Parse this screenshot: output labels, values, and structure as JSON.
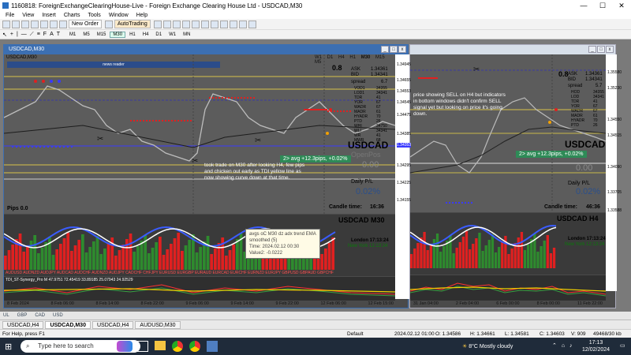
{
  "window": {
    "title": "1160818: ForeignExchangeClearingHouse-Live - Foreign Exchange Clearing House Ltd - USDCAD,M30",
    "minimize": "—",
    "maximize": "☐",
    "close": "✕"
  },
  "menu": [
    "File",
    "View",
    "Insert",
    "Charts",
    "Tools",
    "Window",
    "Help"
  ],
  "toolbar": {
    "new_order": "New Order",
    "autotrading": "AutoTrading"
  },
  "timeframes": [
    "M1",
    "M5",
    "M15",
    "M30",
    "H1",
    "H4",
    "D1",
    "W1",
    "MN"
  ],
  "left_chart": {
    "title": "USDCAD,M30",
    "subtitle": "USDCAD,M30",
    "news": "news reader",
    "tfs": [
      "W1",
      "D1",
      "H4",
      "H1",
      "M30",
      "M15",
      "M5"
    ],
    "value_top": "0.8",
    "info": {
      "ask_label": "ASK",
      "ask": "1.34361",
      "bid_label": "BID",
      "bid": "1.34341",
      "spread_label": "spread",
      "spread": "6.7"
    },
    "indicators": [
      {
        "k": "VOD1",
        "v": "34355"
      },
      {
        "k": "LOD1",
        "v": "34341"
      },
      {
        "k": "TDR",
        "v": "41"
      },
      {
        "k": "YOR",
        "v": "67"
      },
      {
        "k": "WADR",
        "v": "67"
      },
      {
        "k": "MADR",
        "v": "61"
      },
      {
        "k": "HYADR",
        "v": "70"
      },
      {
        "k": "PTD",
        "v": "26"
      },
      {
        "k": "WHI",
        "v": "34750"
      },
      {
        "k": "WLI",
        "v": "34341"
      },
      {
        "k": "WR",
        "v": "41"
      },
      {
        "k": "MWR",
        "v": "68"
      }
    ],
    "symbol": "USDCAD",
    "banner": "2> avg +12.3pips, +0.02%",
    "open_pos": "OpenPos",
    "open_pos_val": "0.00",
    "daily_pl": "Daily P/L",
    "daily_pl_val": "0.02%",
    "candle_time_label": "Candle time:",
    "candle_time": "16:36",
    "pips": "Pips 0.0",
    "note": "took trade on M30 after looking H4, few pips and chicken out early as TDI yellow line as now showing curve down at that time.",
    "prices": [
      "1.34945",
      "1.34655",
      "1.34553",
      "1.34545",
      "1.34475",
      "1.34353",
      "1.34385",
      "1.34295",
      "1.34225",
      "1.34155"
    ],
    "osc_symbol": "USDCAD M30",
    "london": "London 17:13:24",
    "newyork": "New York 12:13:24",
    "pairs": "AUDUSD AUDNZD AUDJPY AUDCAD AUDCHF AUDNZD AUDJPY CADCHF CHFJPY EURUSD EURGBP EURAUD EURCAD EURCHF EURNZD EURJPY GBPUSD GBPAUD GBPCHF",
    "tdi_label": "TDI_ST-Synergy_Pro M 47.9751 72.45419 33.89185 25.07943 24.92529",
    "tooltip": {
      "l1": "avgs oC M30 dz adx trend EMA",
      "l2": "smoothed (5)",
      "l3": "Time: 2024.02.12 00:30",
      "l4": "Value2: -0.0222"
    },
    "dates": [
      "8 Feb 2024",
      "8 Feb 06:00",
      "8 Feb 14:00",
      "8 Feb 22:00",
      "9 Feb 06:00",
      "9 Feb 14:00",
      "9 Feb 22:00",
      "12 Feb 06:00",
      "12 Feb 15:00"
    ]
  },
  "right_chart": {
    "value_top": "0.8",
    "info": {
      "ask_label": "ASK",
      "ask": "1.34361",
      "bid_label": "BID",
      "bid": "1.34341",
      "spread_label": "spread",
      "spread": "5.7"
    },
    "indicators": [
      {
        "k": "HOD",
        "v": "34355"
      },
      {
        "k": "LOD",
        "v": "34341"
      },
      {
        "k": "TDR",
        "v": "41"
      },
      {
        "k": "YOR",
        "v": "67"
      },
      {
        "k": "WADR",
        "v": "67"
      },
      {
        "k": "MADR",
        "v": "61"
      },
      {
        "k": "HYADR",
        "v": "70"
      },
      {
        "k": "PTD",
        "v": "26"
      }
    ],
    "note": "price showing SELL on H4 but indicators in bottom windows didn't confirm SELL signal yet but looking on price it's going down.",
    "symbol": "USDCAD",
    "banner": "2> avg +12.3pips, +0.02%",
    "open_pos_val": "0.00",
    "daily_pl": "Daily P/L",
    "daily_pl_val": "0.02%",
    "candle_time_label": "Candle time:",
    "candle_time": "46:36",
    "osc_symbol": "USDCAD H4",
    "london": "London 17:13:24",
    "newyork": "New York 12:13:24",
    "prices": [
      "1.35580",
      "1.35230",
      "1.34550",
      "1.34515",
      "1.34090",
      "1.33705",
      "1.33588"
    ],
    "dates": [
      "31 Jan 04:00",
      "2 Feb 04:00",
      "6 Feb 00:00",
      "8 Feb 00:00",
      "11 Feb 22:00"
    ]
  },
  "bottom_tabs": [
    "UL",
    "GBP",
    "CAD",
    "USD"
  ],
  "symbol_tabs": [
    "USDCAD,H4",
    "USDCAD,M30",
    "USDCAD,H4",
    "AUDUSD,M30"
  ],
  "status": {
    "help": "For Help, press F1",
    "profile": "Default",
    "time": "2024.02.12 01:00",
    "open": "O: 1.34586",
    "high": "H: 1.34661",
    "low": "L: 1.34581",
    "close": "C: 1.34603",
    "volume": "V: 909",
    "traffic": "49468/30 kb"
  },
  "taskbar": {
    "search_placeholder": "Type here to search",
    "weather": "8°C  Mostly cloudy",
    "clock_time": "17:13",
    "clock_date": "12/02/2024"
  },
  "colors": {
    "accent": "#3c6fb2",
    "bull": "#2e8b2e",
    "bear": "#e02020",
    "banner": "#2e8b57"
  }
}
